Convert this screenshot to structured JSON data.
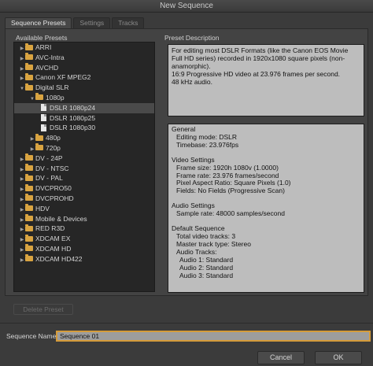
{
  "window": {
    "title": "New Sequence"
  },
  "tabs": [
    {
      "label": "Sequence Presets",
      "active": true
    },
    {
      "label": "Settings",
      "active": false
    },
    {
      "label": "Tracks",
      "active": false
    }
  ],
  "presets": {
    "title": "Available Presets",
    "items": [
      {
        "label": "ARRI",
        "type": "folder",
        "level": 0,
        "expanded": false
      },
      {
        "label": "AVC-Intra",
        "type": "folder",
        "level": 0,
        "expanded": false
      },
      {
        "label": "AVCHD",
        "type": "folder",
        "level": 0,
        "expanded": false
      },
      {
        "label": "Canon XF MPEG2",
        "type": "folder",
        "level": 0,
        "expanded": false
      },
      {
        "label": "Digital SLR",
        "type": "folder",
        "level": 0,
        "expanded": true
      },
      {
        "label": "1080p",
        "type": "folder",
        "level": 1,
        "expanded": true
      },
      {
        "label": "DSLR 1080p24",
        "type": "file",
        "level": 2,
        "selected": true
      },
      {
        "label": "DSLR 1080p25",
        "type": "file",
        "level": 2
      },
      {
        "label": "DSLR 1080p30",
        "type": "file",
        "level": 2
      },
      {
        "label": "480p",
        "type": "folder",
        "level": 1,
        "expanded": false
      },
      {
        "label": "720p",
        "type": "folder",
        "level": 1,
        "expanded": false
      },
      {
        "label": "DV - 24P",
        "type": "folder",
        "level": 0,
        "expanded": false
      },
      {
        "label": "DV - NTSC",
        "type": "folder",
        "level": 0,
        "expanded": false
      },
      {
        "label": "DV - PAL",
        "type": "folder",
        "level": 0,
        "expanded": false
      },
      {
        "label": "DVCPRO50",
        "type": "folder",
        "level": 0,
        "expanded": false
      },
      {
        "label": "DVCPROHD",
        "type": "folder",
        "level": 0,
        "expanded": false
      },
      {
        "label": "HDV",
        "type": "folder",
        "level": 0,
        "expanded": false
      },
      {
        "label": "Mobile & Devices",
        "type": "folder",
        "level": 0,
        "expanded": false
      },
      {
        "label": "RED R3D",
        "type": "folder",
        "level": 0,
        "expanded": false
      },
      {
        "label": "XDCAM EX",
        "type": "folder",
        "level": 0,
        "expanded": false
      },
      {
        "label": "XDCAM HD",
        "type": "folder",
        "level": 0,
        "expanded": false
      },
      {
        "label": "XDCAM HD422",
        "type": "folder",
        "level": 0,
        "expanded": false
      }
    ],
    "delete_label": "Delete Preset"
  },
  "description": {
    "title": "Preset Description",
    "text": "For editing most DSLR Formats (like the Canon EOS Movie Full HD series) recorded in 1920x1080 square pixels (non-anamorphic).\n16:9 Progressive HD video at 23.976 frames per second.\n48 kHz audio."
  },
  "info": {
    "general_title": "General",
    "general": [
      "Editing mode: DSLR",
      "Timebase: 23.976fps"
    ],
    "video_title": "Video Settings",
    "video": [
      "Frame size: 1920h 1080v (1.0000)",
      "Frame rate: 23.976 frames/second",
      "Pixel Aspect Ratio: Square Pixels (1.0)",
      "Fields: No Fields (Progressive Scan)"
    ],
    "audio_title": "Audio Settings",
    "audio": [
      "Sample rate: 48000 samples/second"
    ],
    "sequence_title": "Default Sequence",
    "sequence": [
      "Total video tracks: 3",
      "Master track type: Stereo",
      "Audio Tracks:"
    ],
    "audio_tracks": [
      "Audio 1: Standard",
      "Audio 2: Standard",
      "Audio 3: Standard"
    ]
  },
  "sequence_name": {
    "label": "Sequence Name:",
    "value": "Sequence 01"
  },
  "buttons": {
    "cancel": "Cancel",
    "ok": "OK"
  },
  "colors": {
    "accent": "#d59b3a",
    "folder": "#d9a441"
  }
}
